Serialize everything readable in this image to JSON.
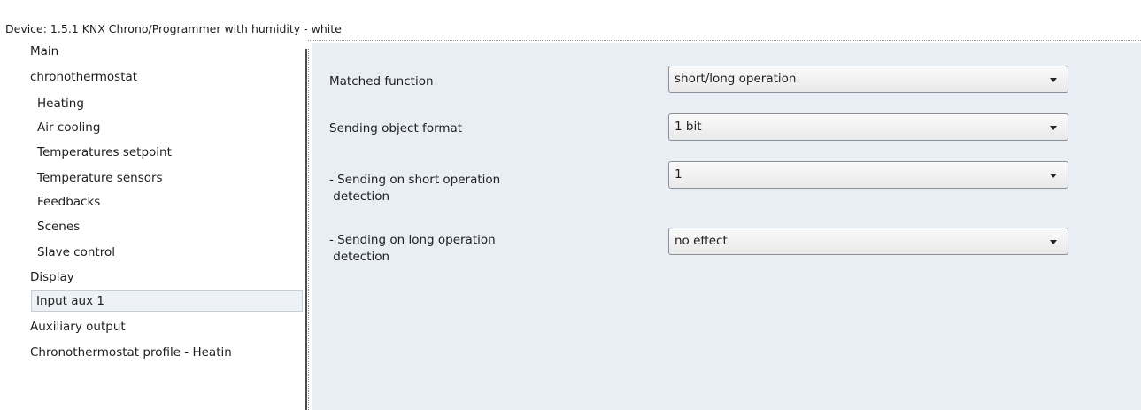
{
  "window": {
    "title": "Device: 1.5.1  KNX Chrono/Programmer with humidity - white"
  },
  "sidebar": {
    "items": [
      {
        "label": "Main"
      },
      {
        "label": "chronothermostat"
      },
      {
        "label": "Heating"
      },
      {
        "label": "Air cooling"
      },
      {
        "label": "Temperatures setpoint"
      },
      {
        "label": "Temperature sensors"
      },
      {
        "label": "Feedbacks"
      },
      {
        "label": "Scenes"
      },
      {
        "label": "Slave control"
      },
      {
        "label": "Display"
      },
      {
        "label": "Input aux 1",
        "selected": true
      },
      {
        "label": "Auxiliary output"
      },
      {
        "label": "Chronothermostat profile - Heatin"
      }
    ]
  },
  "panel": {
    "params": [
      {
        "label": "Matched function",
        "value": "short/long operation"
      },
      {
        "label": "Sending object format",
        "value": "1 bit"
      },
      {
        "label_line1": "- Sending on short operation",
        "label_line2": " detection",
        "value": "1"
      },
      {
        "label_line1": "- Sending on long operation",
        "label_line2": " detection",
        "value": "no effect"
      }
    ]
  },
  "colors": {
    "panel_background": "#e8eef4",
    "selected_item_background": "#eef1f5",
    "selected_item_border": "#c5cfda"
  },
  "icons": {
    "dropdown": "chevron-down-icon"
  }
}
